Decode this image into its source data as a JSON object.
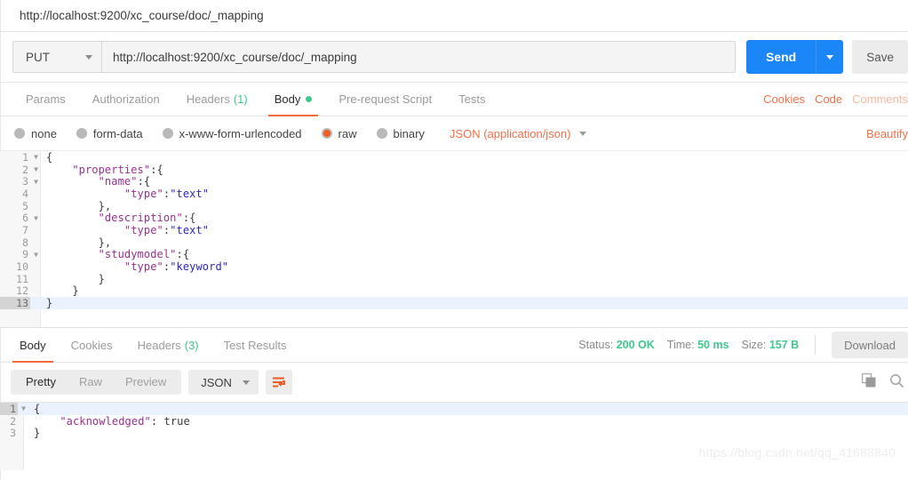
{
  "request_tab": {
    "title": "http://localhost:9200/xc_course/doc/_mapping"
  },
  "url_bar": {
    "method": "PUT",
    "url": "http://localhost:9200/xc_course/doc/_mapping",
    "send_label": "Send",
    "save_label": "Save"
  },
  "request_tabs": [
    {
      "label": "Params",
      "active": false
    },
    {
      "label": "Authorization",
      "active": false
    },
    {
      "label": "Headers",
      "count": "(1)",
      "active": false
    },
    {
      "label": "Body",
      "dot": true,
      "active": true
    },
    {
      "label": "Pre-request Script",
      "active": false
    },
    {
      "label": "Tests",
      "active": false
    }
  ],
  "request_tabs_right": [
    {
      "label": "Cookies",
      "faded": false
    },
    {
      "label": "Code",
      "faded": false
    },
    {
      "label": "Comments",
      "faded": true
    }
  ],
  "body_types": [
    {
      "label": "none",
      "selected": false
    },
    {
      "label": "form-data",
      "selected": false
    },
    {
      "label": "x-www-form-urlencoded",
      "selected": false
    },
    {
      "label": "raw",
      "selected": true
    },
    {
      "label": "binary",
      "selected": false
    }
  ],
  "content_type": "JSON (application/json)",
  "beautify_label": "Beautify",
  "request_body_lines": [
    {
      "n": "1",
      "fold": true,
      "highlight": false,
      "indent": 0,
      "tokens": [
        {
          "t": "{",
          "c": "p"
        }
      ]
    },
    {
      "n": "2",
      "fold": true,
      "highlight": false,
      "indent": 1,
      "tokens": [
        {
          "t": "\"properties\"",
          "c": "k"
        },
        {
          "t": ":{",
          "c": "p"
        }
      ]
    },
    {
      "n": "3",
      "fold": true,
      "highlight": false,
      "indent": 2,
      "tokens": [
        {
          "t": "\"name\"",
          "c": "k"
        },
        {
          "t": ":{",
          "c": "p"
        }
      ]
    },
    {
      "n": "4",
      "fold": false,
      "highlight": false,
      "indent": 3,
      "tokens": [
        {
          "t": "\"type\"",
          "c": "k"
        },
        {
          "t": ":",
          "c": "p"
        },
        {
          "t": "\"text\"",
          "c": "s"
        }
      ]
    },
    {
      "n": "5",
      "fold": false,
      "highlight": false,
      "indent": 2,
      "tokens": [
        {
          "t": "},",
          "c": "p"
        }
      ]
    },
    {
      "n": "6",
      "fold": true,
      "highlight": false,
      "indent": 2,
      "tokens": [
        {
          "t": "\"description\"",
          "c": "k"
        },
        {
          "t": ":{",
          "c": "p"
        }
      ]
    },
    {
      "n": "7",
      "fold": false,
      "highlight": false,
      "indent": 3,
      "tokens": [
        {
          "t": "\"type\"",
          "c": "k"
        },
        {
          "t": ":",
          "c": "p"
        },
        {
          "t": "\"text\"",
          "c": "s"
        }
      ]
    },
    {
      "n": "8",
      "fold": false,
      "highlight": false,
      "indent": 2,
      "tokens": [
        {
          "t": "},",
          "c": "p"
        }
      ]
    },
    {
      "n": "9",
      "fold": true,
      "highlight": false,
      "indent": 2,
      "tokens": [
        {
          "t": "\"studymodel\"",
          "c": "k"
        },
        {
          "t": ":{",
          "c": "p"
        }
      ]
    },
    {
      "n": "10",
      "fold": false,
      "highlight": false,
      "indent": 3,
      "tokens": [
        {
          "t": "\"type\"",
          "c": "k"
        },
        {
          "t": ":",
          "c": "p"
        },
        {
          "t": "\"keyword\"",
          "c": "s"
        }
      ]
    },
    {
      "n": "11",
      "fold": false,
      "highlight": false,
      "indent": 2,
      "tokens": [
        {
          "t": "}",
          "c": "p"
        }
      ]
    },
    {
      "n": "12",
      "fold": false,
      "highlight": false,
      "indent": 1,
      "tokens": [
        {
          "t": "}",
          "c": "p"
        }
      ]
    },
    {
      "n": "13",
      "fold": false,
      "highlight": true,
      "indent": 0,
      "tokens": [
        {
          "t": "}",
          "c": "p"
        }
      ]
    }
  ],
  "response_tabs": [
    {
      "label": "Body",
      "active": true
    },
    {
      "label": "Cookies",
      "active": false
    },
    {
      "label": "Headers",
      "count": "(3)",
      "active": false
    },
    {
      "label": "Test Results",
      "active": false
    }
  ],
  "response_meta": {
    "status_label": "Status:",
    "status_value": "200 OK",
    "time_label": "Time:",
    "time_value": "50 ms",
    "size_label": "Size:",
    "size_value": "157 B",
    "download_label": "Download"
  },
  "response_toolbar": {
    "segments": [
      {
        "label": "Pretty",
        "active": true
      },
      {
        "label": "Raw",
        "active": false
      },
      {
        "label": "Preview",
        "active": false
      }
    ],
    "format": "JSON",
    "wrap_icon": "word-wrap-icon",
    "copy_icon": "copy-icon",
    "search_icon": "search-icon"
  },
  "response_body_lines": [
    {
      "n": "1",
      "fold": true,
      "highlight": true,
      "indent": 0,
      "tokens": [
        {
          "t": "{",
          "c": "p"
        }
      ]
    },
    {
      "n": "2",
      "fold": false,
      "highlight": false,
      "indent": 1,
      "tokens": [
        {
          "t": "\"acknowledged\"",
          "c": "k"
        },
        {
          "t": ": true",
          "c": "p"
        }
      ]
    },
    {
      "n": "3",
      "fold": false,
      "highlight": false,
      "indent": 0,
      "tokens": [
        {
          "t": "}",
          "c": "p"
        }
      ]
    }
  ],
  "watermark": "https://blog.csdn.net/qq_41688840",
  "colors": {
    "accent_orange": "#f26b3a",
    "send_blue": "#1a86f7",
    "status_green": "#3ec88b",
    "json_key": "#9b2f8f",
    "json_string": "#2a28c9"
  }
}
